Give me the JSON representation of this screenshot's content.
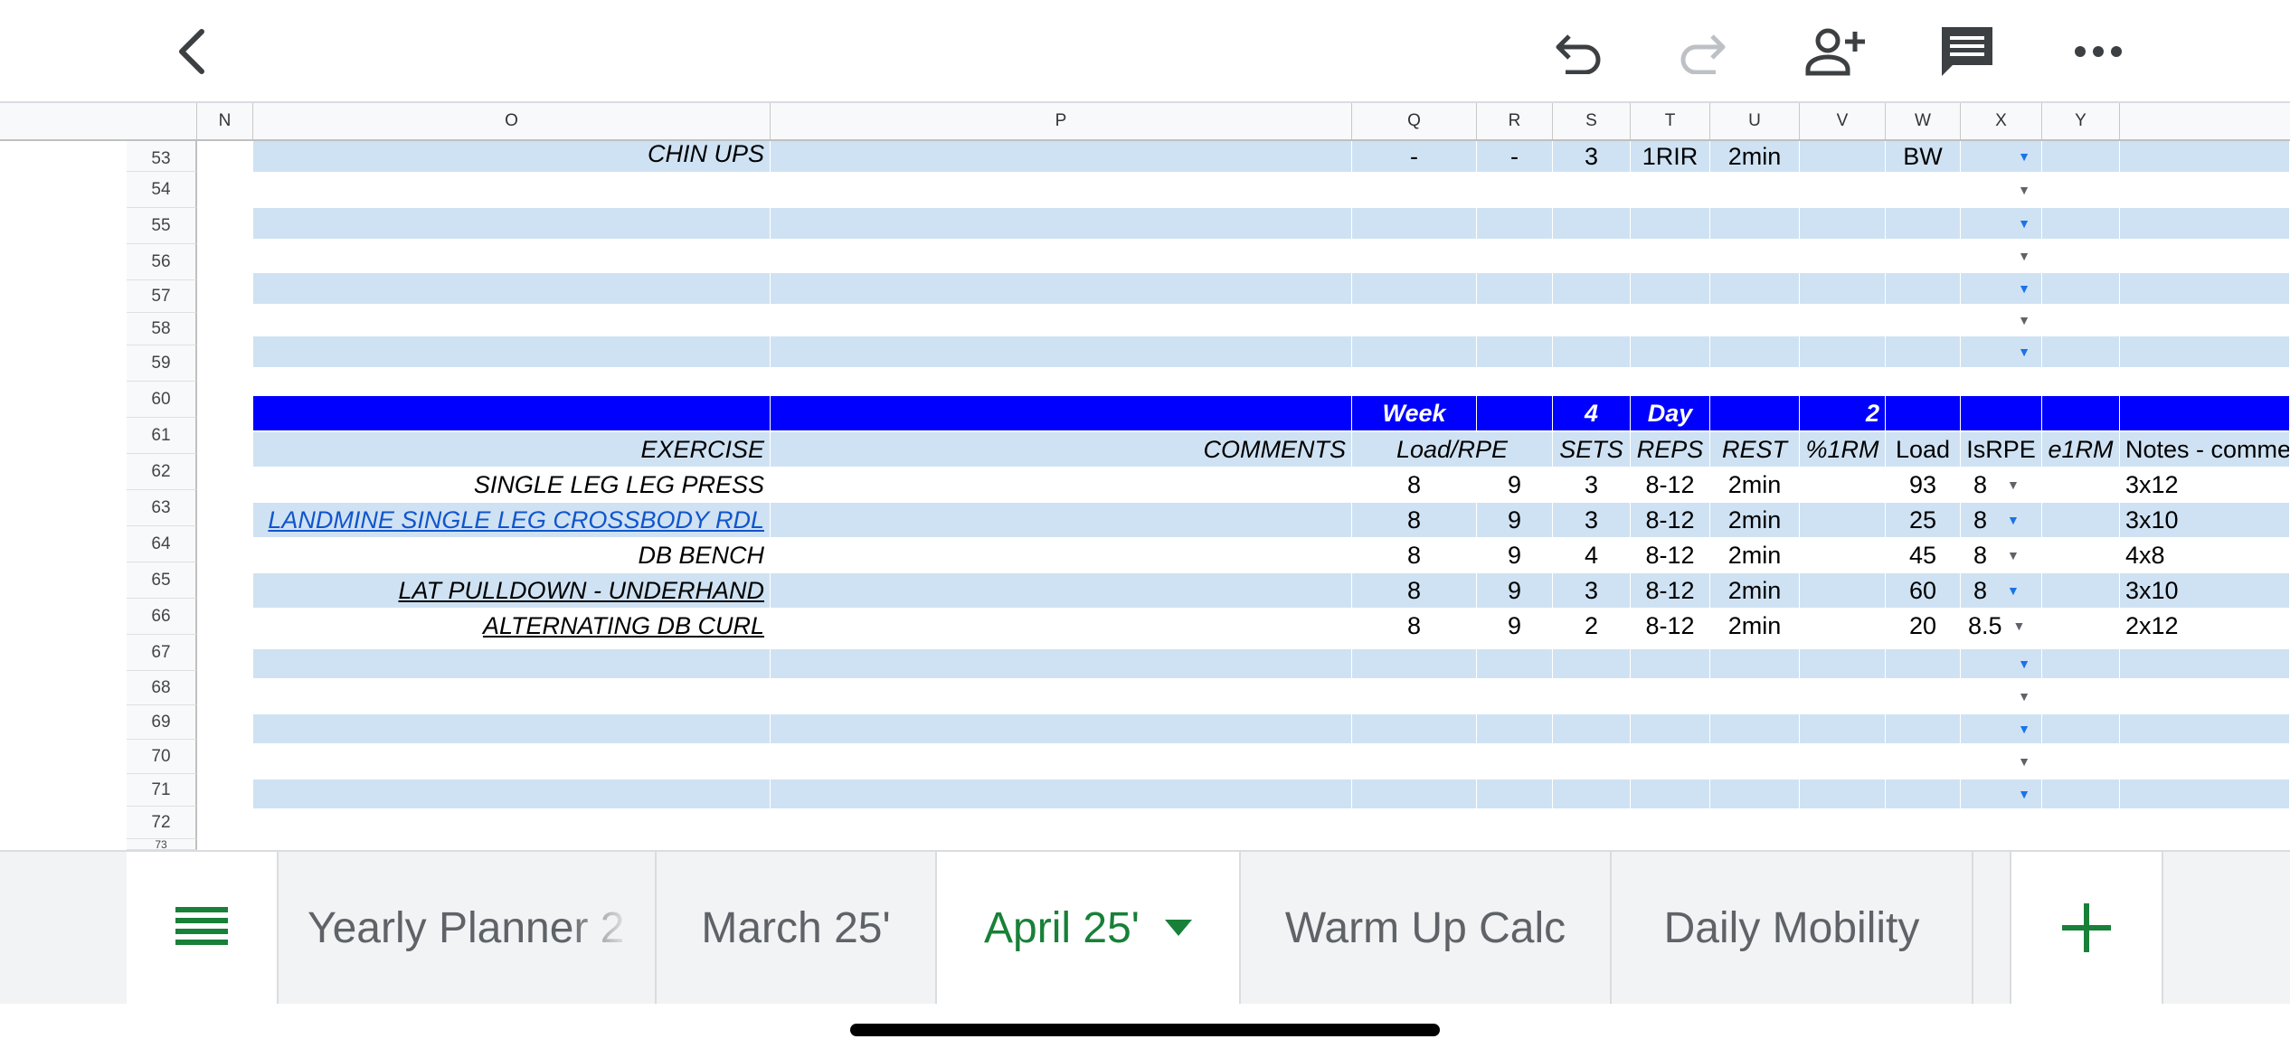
{
  "toolbar": {
    "icons": [
      "back-icon",
      "undo-icon",
      "redo-icon",
      "add-person-icon",
      "comment-icon",
      "more-icon"
    ]
  },
  "columns": [
    "N",
    "O",
    "P",
    "Q",
    "R",
    "S",
    "T",
    "U",
    "V",
    "W",
    "X",
    "Y"
  ],
  "rows": {
    "r53": {
      "num": "53",
      "O": "CHIN UPS",
      "Q": "-",
      "R": "-",
      "S": "3",
      "T": "1RIR",
      "U": "2min",
      "W": "BW"
    },
    "r54": {
      "num": "54"
    },
    "r55": {
      "num": "55"
    },
    "r56": {
      "num": "56"
    },
    "r57": {
      "num": "57"
    },
    "r58": {
      "num": "58"
    },
    "r59": {
      "num": "59"
    },
    "r60": {
      "num": "60"
    },
    "r61": {
      "num": "61",
      "Q": "Week",
      "S": "4",
      "T": "Day",
      "V": "2"
    },
    "r62": {
      "num": "62",
      "O": "EXERCISE",
      "P": "COMMENTS",
      "Q": "Load/RPE",
      "S": "SETS",
      "T": "REPS",
      "U": "REST",
      "V": "%1RM",
      "W": "Load",
      "X": "IsRPE",
      "Y": "e1RM",
      "Z": "Notes - comme"
    },
    "r63": {
      "num": "63",
      "O": "SINGLE LEG LEG PRESS",
      "Q": "8",
      "R": "9",
      "S": "3",
      "T": "8-12",
      "U": "2min",
      "W": "93",
      "X": "8",
      "Z": "3x12"
    },
    "r64": {
      "num": "64",
      "O": "LANDMINE SINGLE LEG CROSSBODY RDL",
      "Q": "8",
      "R": "9",
      "S": "3",
      "T": "8-12",
      "U": "2min",
      "W": "25",
      "X": "8",
      "Z": "3x10"
    },
    "r65": {
      "num": "65",
      "O": "DB BENCH",
      "Q": "8",
      "R": "9",
      "S": "4",
      "T": "8-12",
      "U": "2min",
      "W": "45",
      "X": "8",
      "Z": "4x8"
    },
    "r66": {
      "num": "66",
      "O": "LAT PULLDOWN - UNDERHAND",
      "Q": "8",
      "R": "9",
      "S": "3",
      "T": "8-12",
      "U": "2min",
      "W": "60",
      "X": "8",
      "Z": "3x10"
    },
    "r67": {
      "num": "67",
      "O": "ALTERNATING DB CURL",
      "Q": "8",
      "R": "9",
      "S": "2",
      "T": "8-12",
      "U": "2min",
      "W": "20",
      "X": "8.5",
      "Z": "2x12"
    },
    "r68": {
      "num": "68"
    },
    "r69": {
      "num": "69"
    },
    "r70": {
      "num": "70"
    },
    "r71": {
      "num": "71"
    },
    "r72": {
      "num": "72"
    },
    "r73": {
      "num": "73"
    }
  },
  "tabs": {
    "menu_icon": "list-icon",
    "items": [
      "Yearly Planner 2",
      "March 25'",
      "April 25'",
      "Warm Up Calc",
      "Daily Mobility"
    ],
    "active": "April 25'",
    "add_icon": "plus-icon"
  },
  "colors": {
    "header_blue": "#0000ff",
    "band_blue": "#cfe2f3",
    "active_tab": "#188038",
    "link": "#1155cc"
  }
}
